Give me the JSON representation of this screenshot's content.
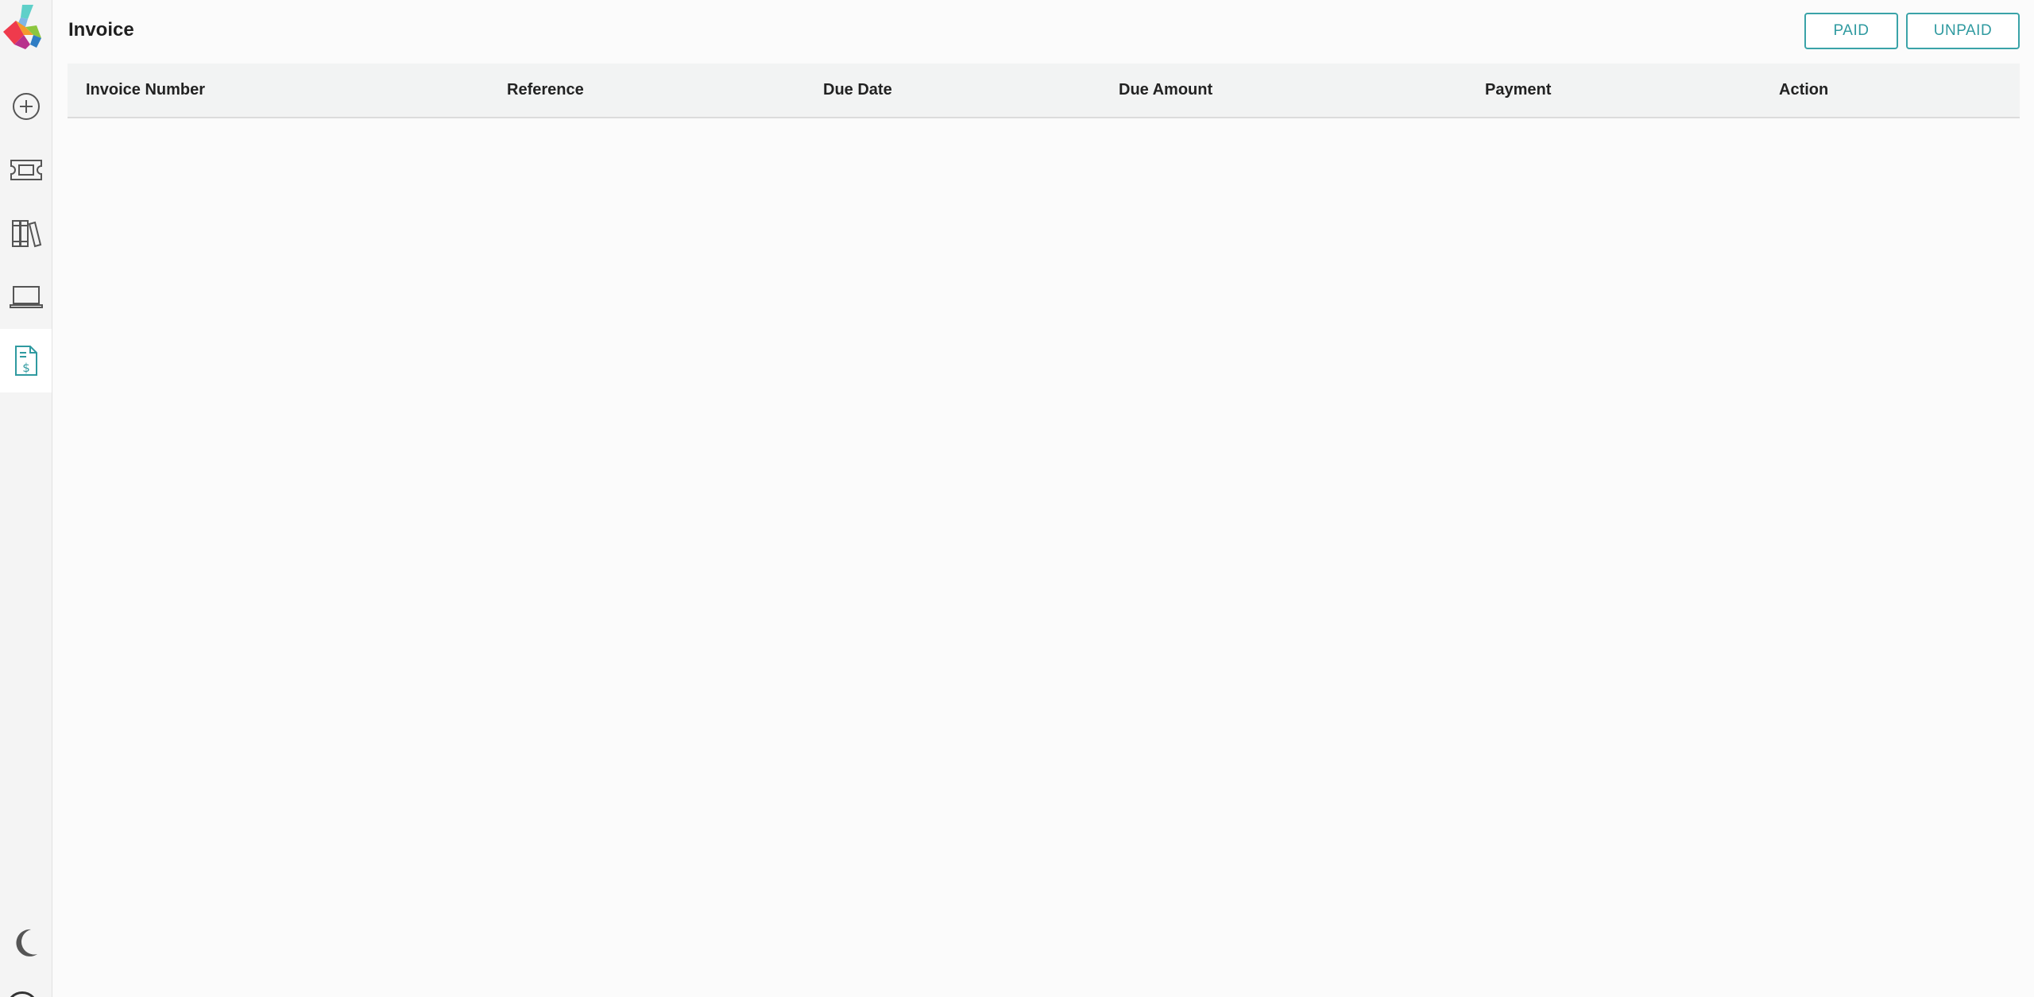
{
  "header": {
    "title": "Invoice",
    "filters": {
      "paid_label": "PAID",
      "unpaid_label": "UNPAID"
    }
  },
  "sidebar": {
    "items": [
      {
        "name": "add",
        "icon": "plus-circle-icon"
      },
      {
        "name": "tickets",
        "icon": "ticket-icon"
      },
      {
        "name": "library",
        "icon": "books-icon"
      },
      {
        "name": "devices",
        "icon": "laptop-icon"
      },
      {
        "name": "invoice",
        "icon": "invoice-dollar-icon",
        "active": true
      }
    ],
    "theme_icon": "moon-icon"
  },
  "table": {
    "columns": [
      "Invoice Number",
      "Reference",
      "Due Date",
      "Due Amount",
      "Payment",
      "Action"
    ],
    "rows": []
  },
  "colors": {
    "accent": "#3aa3a8",
    "sidebar_bg": "#f4f4f4",
    "header_row_bg": "#f2f3f3",
    "page_bg": "#fbfbfb"
  }
}
